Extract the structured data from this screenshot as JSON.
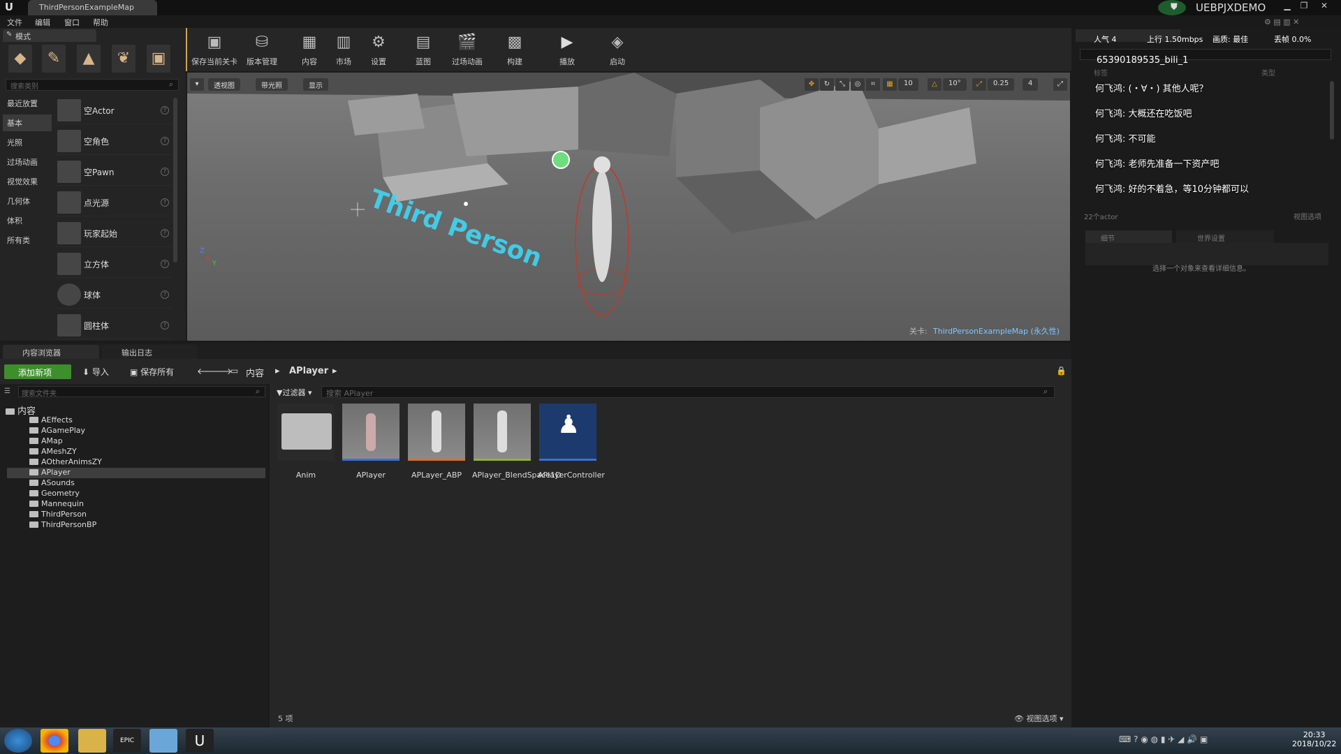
{
  "window": {
    "tab_title": "ThirdPersonExampleMap",
    "project_name": "UEBPJXDEMO"
  },
  "menu": [
    "文件",
    "编辑",
    "窗口",
    "帮助"
  ],
  "modes": {
    "tab_label": "模式",
    "search_placeholder": "搜索类别",
    "categories": [
      "最近放置",
      "基本",
      "光照",
      "过场动画",
      "视觉效果",
      "几何体",
      "体积",
      "所有类"
    ],
    "active_category": "基本",
    "actors": [
      "空Actor",
      "空角色",
      "空Pawn",
      "点光源",
      "玩家起始",
      "立方体",
      "球体",
      "圆柱体"
    ]
  },
  "toolbar": {
    "buttons": [
      "保存当前关卡",
      "版本管理",
      "内容",
      "市场",
      "设置",
      "蓝图",
      "过场动画",
      "构建",
      "播放",
      "启动"
    ]
  },
  "viewport": {
    "perspective_label": "透视图",
    "lit_label": "带光照",
    "show_label": "显示",
    "grid_snap": "10",
    "rotation_snap": "10°",
    "scale_snap": "0.25",
    "camera_speed": "4",
    "level_prefix": "关卡:",
    "level_name": "ThirdPersonExampleMap (永久性)",
    "floor_text": "Third Person"
  },
  "stream_overlay": {
    "popularity": "人气 4",
    "upload": "上行 1.50mbps",
    "quality": "画质: 最佳",
    "drop": "丢帧 0.0%",
    "room_id": "65390189535_bili_1",
    "chat": [
      "何飞鸿: (・∀・) 其他人呢？",
      "何飞鸿: 大概还在吃饭吧",
      "何飞鸿: 不可能",
      "何飞鸿: 老师先准备一下资产吧",
      "何飞鸿: 好的不着急，等10分钟都可以"
    ]
  },
  "outliner": {
    "col_label": "标签",
    "col_type": "类型",
    "actor_count": "22个actor",
    "view_options": "视图选项",
    "details_tab": "细节",
    "world_settings_tab": "世界设置",
    "details_hint": "选择一个对象来查看详细信息。"
  },
  "content_browser": {
    "tab_label": "内容浏览器",
    "output_tab_label": "输出日志",
    "add_new": "添加新项",
    "import": "导入",
    "save_all": "保存所有",
    "crumb_root": "内容",
    "crumb_current": "APlayer",
    "folder_search_placeholder": "搜索文件夹",
    "filters_label": "过滤器",
    "asset_search_placeholder": "搜索 APlayer",
    "root_folder": "内容",
    "folders": [
      "AEffects",
      "AGamePlay",
      "AMap",
      "AMeshZY",
      "AOtherAnimsZY",
      "APlayer",
      "ASounds",
      "Geometry",
      "Mannequin",
      "ThirdPerson",
      "ThirdPersonBP"
    ],
    "selected_folder": "APlayer",
    "assets": [
      "Anim",
      "APlayer",
      "APLayer_ABP",
      "APlayer_BlendSpace1D",
      "APlayerController"
    ],
    "item_count": "5 项",
    "view_options": "视图选项"
  },
  "taskbar": {
    "time": "20:33",
    "date": "2018/10/22"
  }
}
